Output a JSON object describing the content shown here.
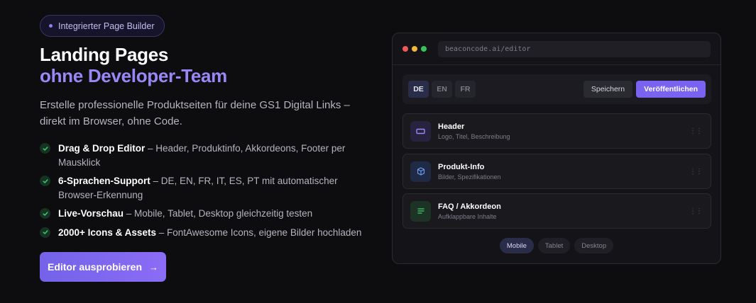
{
  "badge": {
    "icon": "dot-icon",
    "label": "Integrierter Page Builder"
  },
  "hero": {
    "title_line1": "Landing Pages",
    "title_line2": "ohne Developer-Team",
    "lead_line1": "Erstelle professionelle Produktseiten für deine GS1 Digital Links –",
    "lead_line2": "direkt im Browser, ohne Code."
  },
  "features": [
    {
      "title": "Drag & Drop Editor",
      "text": " – Header, Produktinfo, Akkordeons, Footer per Mausklick"
    },
    {
      "title": "6-Sprachen-Support",
      "text": " – DE, EN, FR, IT, ES, PT mit automatischer Browser-Erkennung"
    },
    {
      "title": "Live-Vorschau",
      "text": " – Mobile, Tablet, Desktop gleichzeitig testen"
    },
    {
      "title": "2000+ Icons & Assets",
      "text": " – FontAwesome Icons, eigene Bilder hochladen"
    }
  ],
  "cta": {
    "label": "Editor ausprobieren",
    "icon": "arrow-right-icon"
  },
  "editor": {
    "url": "beaconcode.ai/editor",
    "languages": [
      "DE",
      "EN",
      "FR"
    ],
    "active_language": "DE",
    "save_label": "Speichern",
    "publish_label": "Veröffentlichen",
    "blocks": [
      {
        "title": "Header",
        "subtitle": "Logo, Titel, Beschreibung",
        "icon": "layout-header-icon"
      },
      {
        "title": "Produkt-Info",
        "subtitle": "Bilder, Spezifikationen",
        "icon": "cube-icon"
      },
      {
        "title": "FAQ / Akkordeon",
        "subtitle": "Aufklappbare Inhalte",
        "icon": "list-icon"
      }
    ],
    "devices": [
      "Mobile",
      "Tablet",
      "Desktop"
    ],
    "active_device": "Mobile"
  },
  "colors": {
    "background": "#0d0d10",
    "accent": "#7a63f1",
    "accent_text": "#9a86f5",
    "check_green": "#3ecf6e"
  }
}
